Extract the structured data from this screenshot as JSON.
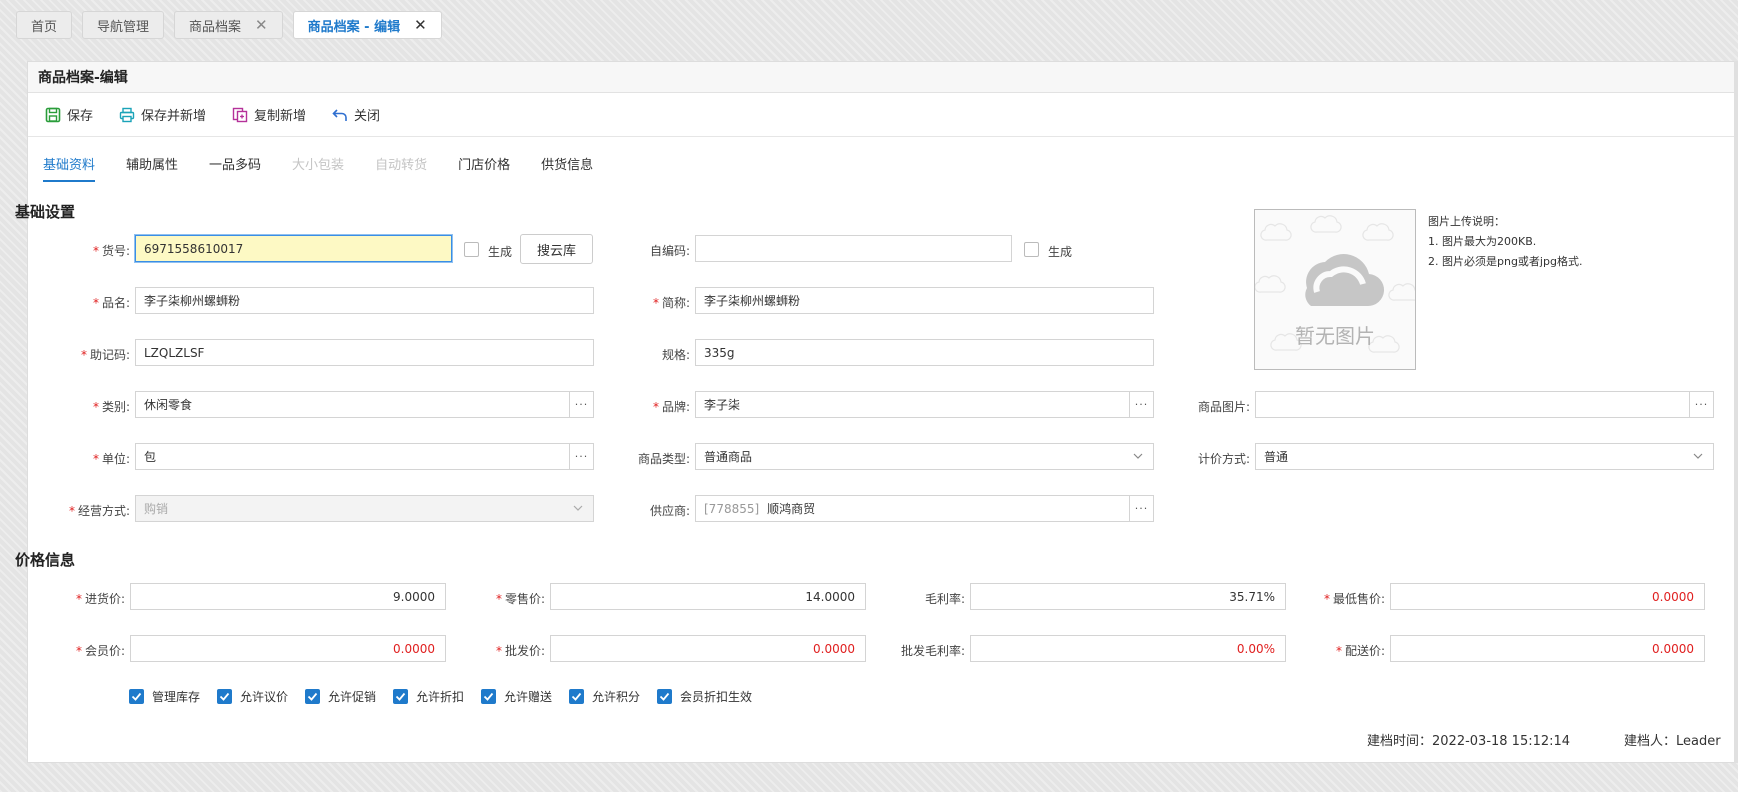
{
  "top_tabs": [
    {
      "label": "首页"
    },
    {
      "label": "导航管理"
    },
    {
      "label": "商品档案",
      "close": "✕"
    },
    {
      "label": "商品档案 - 编辑",
      "close": "✕"
    }
  ],
  "panel": {
    "title": "商品档案-编辑"
  },
  "toolbar": {
    "save": "保存",
    "save_new": "保存并新增",
    "copy_new": "复制新增",
    "close": "关闭"
  },
  "subtabs": [
    "基础资料",
    "辅助属性",
    "一品多码",
    "大小包装",
    "自动转货",
    "门店价格",
    "供货信息"
  ],
  "basic": {
    "section_title": "基础设置",
    "code_label": "货号:",
    "code_value": "6971558610017",
    "gen_label": "生成",
    "cloud_button": "搜云库",
    "selfcode_label": "自编码:",
    "selfcode_value": "",
    "gen2_label": "生成",
    "name_label": "品名:",
    "name_value": "李子柒柳州螺蛳粉",
    "short_label": "简称:",
    "short_value": "李子柒柳州螺蛳粉",
    "mnemonic_label": "助记码:",
    "mnemonic_value": "LZQLZLSF",
    "spec_label": "规格:",
    "spec_value": "335g",
    "category_label": "类别:",
    "category_value": "休闲零食",
    "brand_label": "品牌:",
    "brand_value": "李子柒",
    "image_label": "商品图片:",
    "image_value": "",
    "unit_label": "单位:",
    "unit_value": "包",
    "type_label": "商品类型:",
    "type_value": "普通商品",
    "pricing_label": "计价方式:",
    "pricing_value": "普通",
    "mode_label": "经营方式:",
    "mode_value": "购销",
    "supplier_label": "供应商:",
    "supplier_code": "[778855]",
    "supplier_name": "顺鸿商贸",
    "dots": "···"
  },
  "image": {
    "placeholder": "暂无图片",
    "note_title": "图片上传说明：",
    "note_1": "1. 图片最大为200KB.",
    "note_2": "2. 图片必须是png或者jpg格式."
  },
  "price": {
    "section_title": "价格信息",
    "purchase_label": "进货价:",
    "purchase_value": "9.0000",
    "retail_label": "零售价:",
    "retail_value": "14.0000",
    "margin_label": "毛利率:",
    "margin_value": "35.71%",
    "min_label": "最低售价:",
    "min_value": "0.0000",
    "member_label": "会员价:",
    "member_value": "0.0000",
    "wholesale_label": "批发价:",
    "wholesale_value": "0.0000",
    "wmargin_label": "批发毛利率:",
    "wmargin_value": "0.00%",
    "delivery_label": "配送价:",
    "delivery_value": "0.0000"
  },
  "checkboxes": [
    "管理库存",
    "允许议价",
    "允许促销",
    "允许折扣",
    "允许赠送",
    "允许积分",
    "会员折扣生效"
  ],
  "footer": {
    "created_time": "建档时间：2022-03-18 15:12:14",
    "creator": "建档人：Leader"
  },
  "colors": {
    "accent": "#1f7acb",
    "required": "#e02020",
    "focus_bg": "#fdf9c4"
  }
}
